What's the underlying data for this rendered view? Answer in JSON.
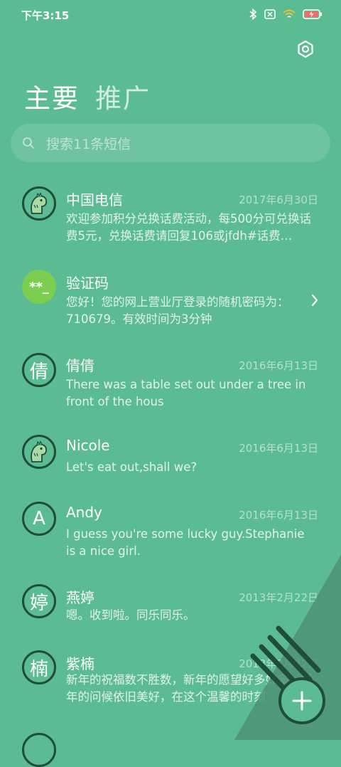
{
  "status_bar": {
    "time": "下午3:15",
    "icons": [
      "bluetooth-icon",
      "sim-disabled-icon",
      "wifi-icon",
      "battery-charging-icon"
    ]
  },
  "header": {
    "settings_icon": "settings-icon",
    "tabs": [
      {
        "label": "主要",
        "active": true
      },
      {
        "label": "推广",
        "active": false
      }
    ]
  },
  "search": {
    "placeholder": "搜索11条短信",
    "icon": "search-icon"
  },
  "conversations": [
    {
      "name": "中国电信",
      "date": "2017年6月30日",
      "preview": "欢迎参加积分兑换话费活动，每500分可兑换话费5元，兑换话费请回复106或jfdh#话费…",
      "avatar": "dino-icon"
    },
    {
      "name": "验证码",
      "date": "",
      "preview": "您好！您的网上营业厅登录的随机密码为：710679。有效时间为3分钟",
      "avatar_text": "**_",
      "chevron": "chevron-right-icon"
    },
    {
      "name": "倩倩",
      "date": "2016年6月13日",
      "preview": "There was a table set out under a tree in front of the hous",
      "avatar_text": "倩"
    },
    {
      "name": "Nicole",
      "date": "2016年6月13日",
      "preview": "Let's eat out,shall we?",
      "avatar": "dino-icon"
    },
    {
      "name": "Andy",
      "date": "2016年6月13日",
      "preview": "I guess you're some lucky guy.Stephanie is a nice girl.",
      "avatar_text": "A"
    },
    {
      "name": "燕婷",
      "date": "2013年2月22日",
      "preview": "嗯。收到啦。同乐同乐。",
      "avatar_text": "婷"
    },
    {
      "name": "紫楠",
      "date": "2013年2月22日",
      "preview": "新年的祝福数不胜数，新年的愿望好多好多，新年的问候依旧美好，在这个温馨的时刻",
      "avatar_text": "楠"
    }
  ],
  "fab": {
    "icon": "plus-icon"
  },
  "colors": {
    "background": "#5bbb93",
    "dark_accent": "#1f4d3a",
    "code_avatar": "#7ccf4e",
    "corner_triangle": "#4e9274"
  }
}
